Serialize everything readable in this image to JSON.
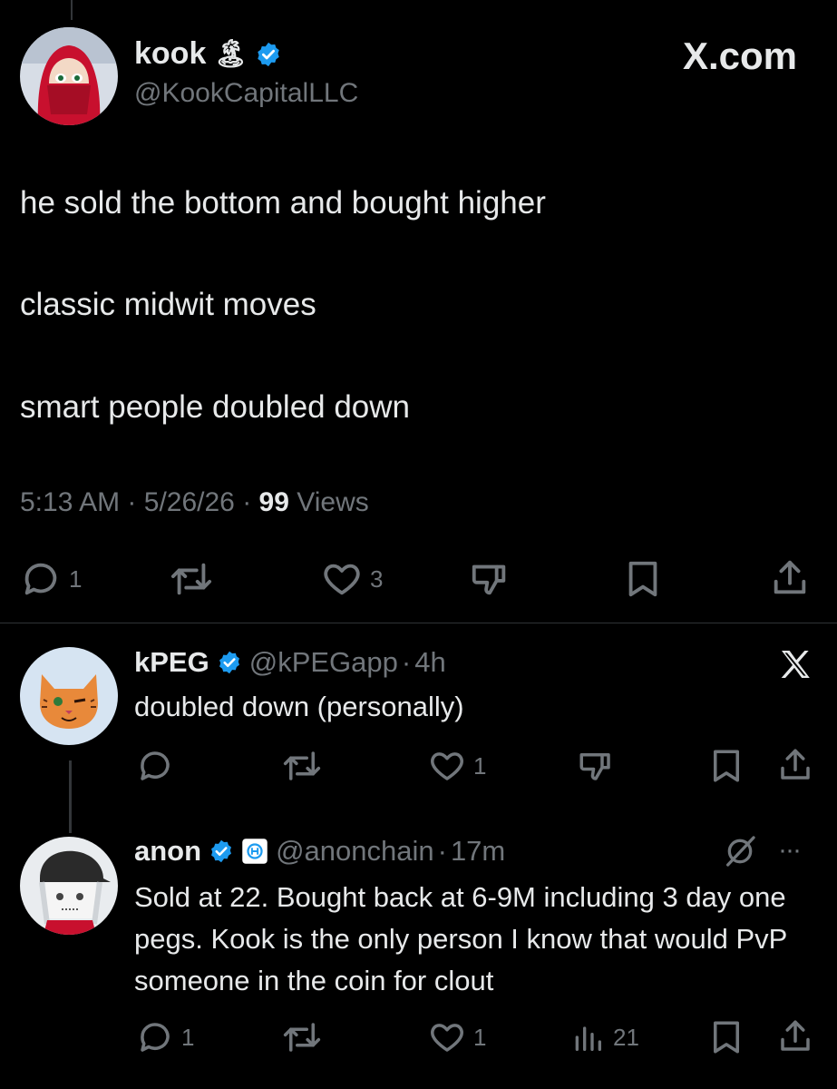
{
  "main_tweet": {
    "author_name": "kook",
    "author_emoji": "🏝",
    "handle": "@KookCapitalLLC",
    "brand": "X.com",
    "lines": [
      "he sold the bottom and bought higher",
      "classic midwit moves",
      "smart people doubled down"
    ],
    "time": "5:13 AM",
    "date": "5/26/26",
    "views_count": "99",
    "views_label": "Views",
    "separator": "·",
    "reply_count": "1",
    "like_count": "3"
  },
  "reply1": {
    "name": "kPEG",
    "handle": "@kPEGapp",
    "separator": "·",
    "time": "4h",
    "text": "doubled down (personally)",
    "like_count": "1"
  },
  "reply2": {
    "name": "anon",
    "handle": "@anonchain",
    "separator": "·",
    "time": "17m",
    "more": "···",
    "text": "Sold at 22. Bought back at 6-9M including 3 day one pegs. Kook is the only person I know that would PvP someone in the coin for clout",
    "reply_count": "1",
    "like_count": "1",
    "views_count": "21"
  },
  "colors": {
    "background": "#000000",
    "text": "#e7e9ea",
    "secondary": "#71767b",
    "verified": "#1d9bf0"
  }
}
